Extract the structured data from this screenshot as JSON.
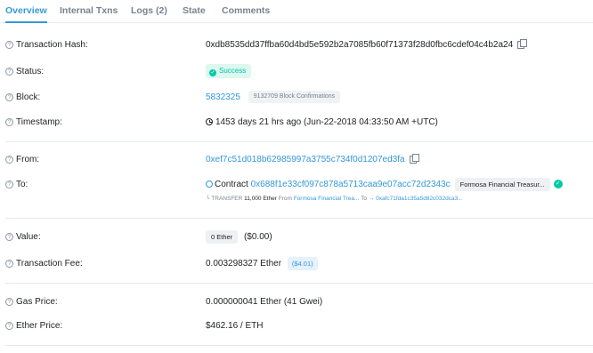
{
  "tabs": [
    {
      "label": "Overview"
    },
    {
      "label": "Internal Txns"
    },
    {
      "label": "Logs (2)"
    },
    {
      "label": "State"
    },
    {
      "label": "Comments"
    }
  ],
  "fields": {
    "tx_hash": {
      "label": "Transaction Hash:",
      "value": "0xdb8535dd37ffba60d4bd5e592b2a7085fb60f71373f28d0fbc6cdef04c4b2a24"
    },
    "status": {
      "label": "Status:",
      "value": "Success"
    },
    "block": {
      "label": "Block:",
      "value": "5832325",
      "confirmations": "9132709 Block Confirmations"
    },
    "timestamp": {
      "label": "Timestamp:",
      "value": "1453 days 21 hrs ago (Jun-22-2018 04:33:50 AM +UTC)"
    },
    "from": {
      "label": "From:",
      "value": "0xef7c51d018b62985997a3755c734f0d1207ed3fa"
    },
    "to": {
      "label": "To:",
      "contract_prefix": "Contract",
      "address": "0x688f1e33cf097c878a5713caa9e07acc72d2343c",
      "name_tag": "Formosa Financial Treasur...",
      "transfer": {
        "prefix": "└ TRANSFER",
        "amount": "11,000 Ether",
        "from_word": "From",
        "from_name": "Formosa Financial Trea...",
        "to_word": "To",
        "to_address": "→ 0xafc71fda1c35a5d82c032dca3..."
      }
    },
    "value": {
      "label": "Value:",
      "badge": "0 Ether",
      "usd": "($0.00)"
    },
    "tx_fee": {
      "label": "Transaction Fee:",
      "value": "0.003298327 Ether",
      "usd": "($4.01)"
    },
    "gas_price": {
      "label": "Gas Price:",
      "value": "0.000000041 Ether (41 Gwei)"
    },
    "ether_price": {
      "label": "Ether Price:",
      "value": "$462.16 / ETH"
    }
  },
  "colors": {
    "accent": "#3498db",
    "success": "#00c9a7",
    "muted": "#77838f",
    "border": "#e7eaf3"
  }
}
